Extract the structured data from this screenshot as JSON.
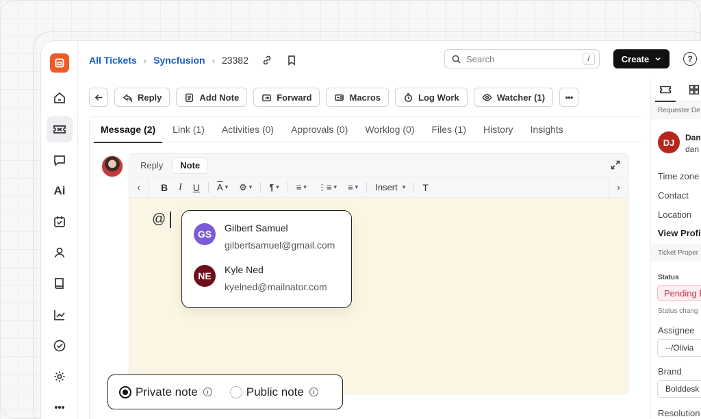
{
  "breadcrumb": {
    "all_tickets": "All Tickets",
    "project": "Syncfusion",
    "ticket_id": "23382"
  },
  "search": {
    "placeholder": "Search",
    "shortcut": "/"
  },
  "header": {
    "create_label": "Create",
    "help_label": "?"
  },
  "sidebar": {
    "items": [
      {
        "icon": "home-icon"
      },
      {
        "icon": "ticket-icon",
        "active": true
      },
      {
        "icon": "chat-icon"
      },
      {
        "icon": "ai-icon",
        "label": "Ai"
      },
      {
        "icon": "task-icon"
      },
      {
        "icon": "contact-icon"
      },
      {
        "icon": "knowledge-book-icon"
      },
      {
        "icon": "reports-chart-icon"
      },
      {
        "icon": "approval-check-icon"
      },
      {
        "icon": "settings-gear-icon"
      },
      {
        "icon": "more-dots-icon"
      }
    ]
  },
  "toolbar": {
    "reply": "Reply",
    "add_note": "Add Note",
    "forward": "Forward",
    "macros": "Macros",
    "log_work": "Log Work",
    "watcher": "Watcher (1)"
  },
  "tabs": [
    "Message (2)",
    "Link (1)",
    "Activities (0)",
    "Approvals (0)",
    "Worklog (0)",
    "Files (1)",
    "History",
    "Insights"
  ],
  "editor": {
    "tabs": [
      "Reply",
      "Note"
    ],
    "active_tab": "Note",
    "insert_label": "Insert",
    "typed_text": "@"
  },
  "mentions": [
    {
      "initials": "GS",
      "name": "Gilbert Samuel",
      "email": "gilbertsamuel@gmail.com",
      "color": "#7b5bd6"
    },
    {
      "initials": "NE",
      "name": "Kyle Ned",
      "email": "kyelned@mailnator.com",
      "color": "#6e0f1b"
    }
  ],
  "note_visibility": {
    "private_label": "Private note",
    "public_label": "Public note",
    "selected": "private"
  },
  "right_panel": {
    "requester_section": "Requester De",
    "requester_initials": "DJ",
    "requester_name": "Dan",
    "requester_email": "dan",
    "time_zone": "Time zone",
    "contact": "Contact",
    "location": "Location",
    "view_profile": "View Profile",
    "ticket_section": "Ticket Proper",
    "status_label": "Status",
    "status_value": "Pending E",
    "status_note": "Status chang",
    "assignee_label": "Assignee",
    "assignee_value": "--/Olivia",
    "brand_label": "Brand",
    "brand_value": "Bolddesk",
    "resolution_label": "Resolution",
    "status_color": "#c4314b"
  }
}
